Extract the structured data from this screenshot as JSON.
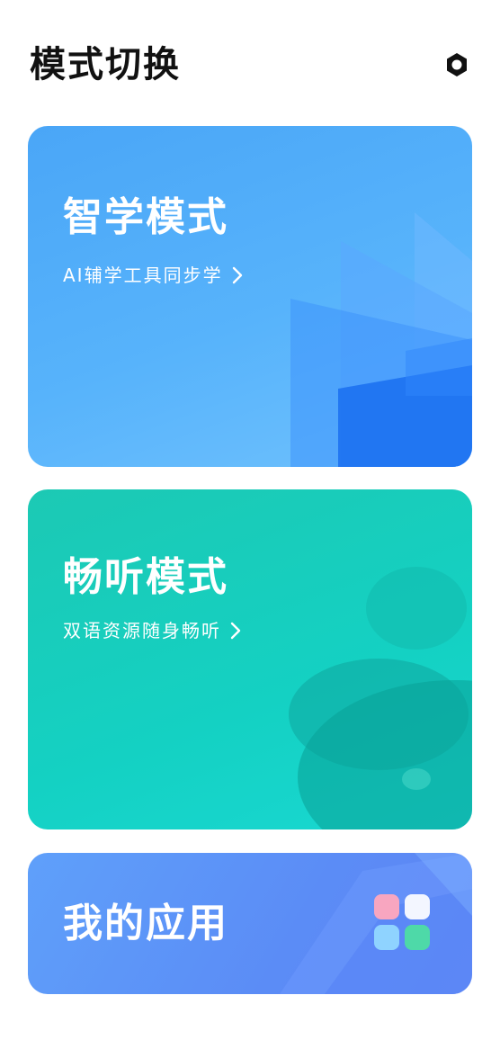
{
  "header": {
    "title": "模式切换",
    "settings_icon": "hexagon-settings-icon"
  },
  "cards": [
    {
      "title": "智学模式",
      "subtitle": "AI辅学工具同步学",
      "icon": "chevron-right-icon",
      "color": "#4aa6f7"
    },
    {
      "title": "畅听模式",
      "subtitle": "双语资源随身畅听",
      "icon": "chevron-right-icon",
      "color": "#14d1c3"
    },
    {
      "title": "我的应用",
      "icon": "apps-grid-icon",
      "color": "#5b8cf6"
    }
  ],
  "app_tile_colors": [
    "#f8a6c0",
    "#f3f6ff",
    "#8fd3ff",
    "#4ed9a8"
  ]
}
